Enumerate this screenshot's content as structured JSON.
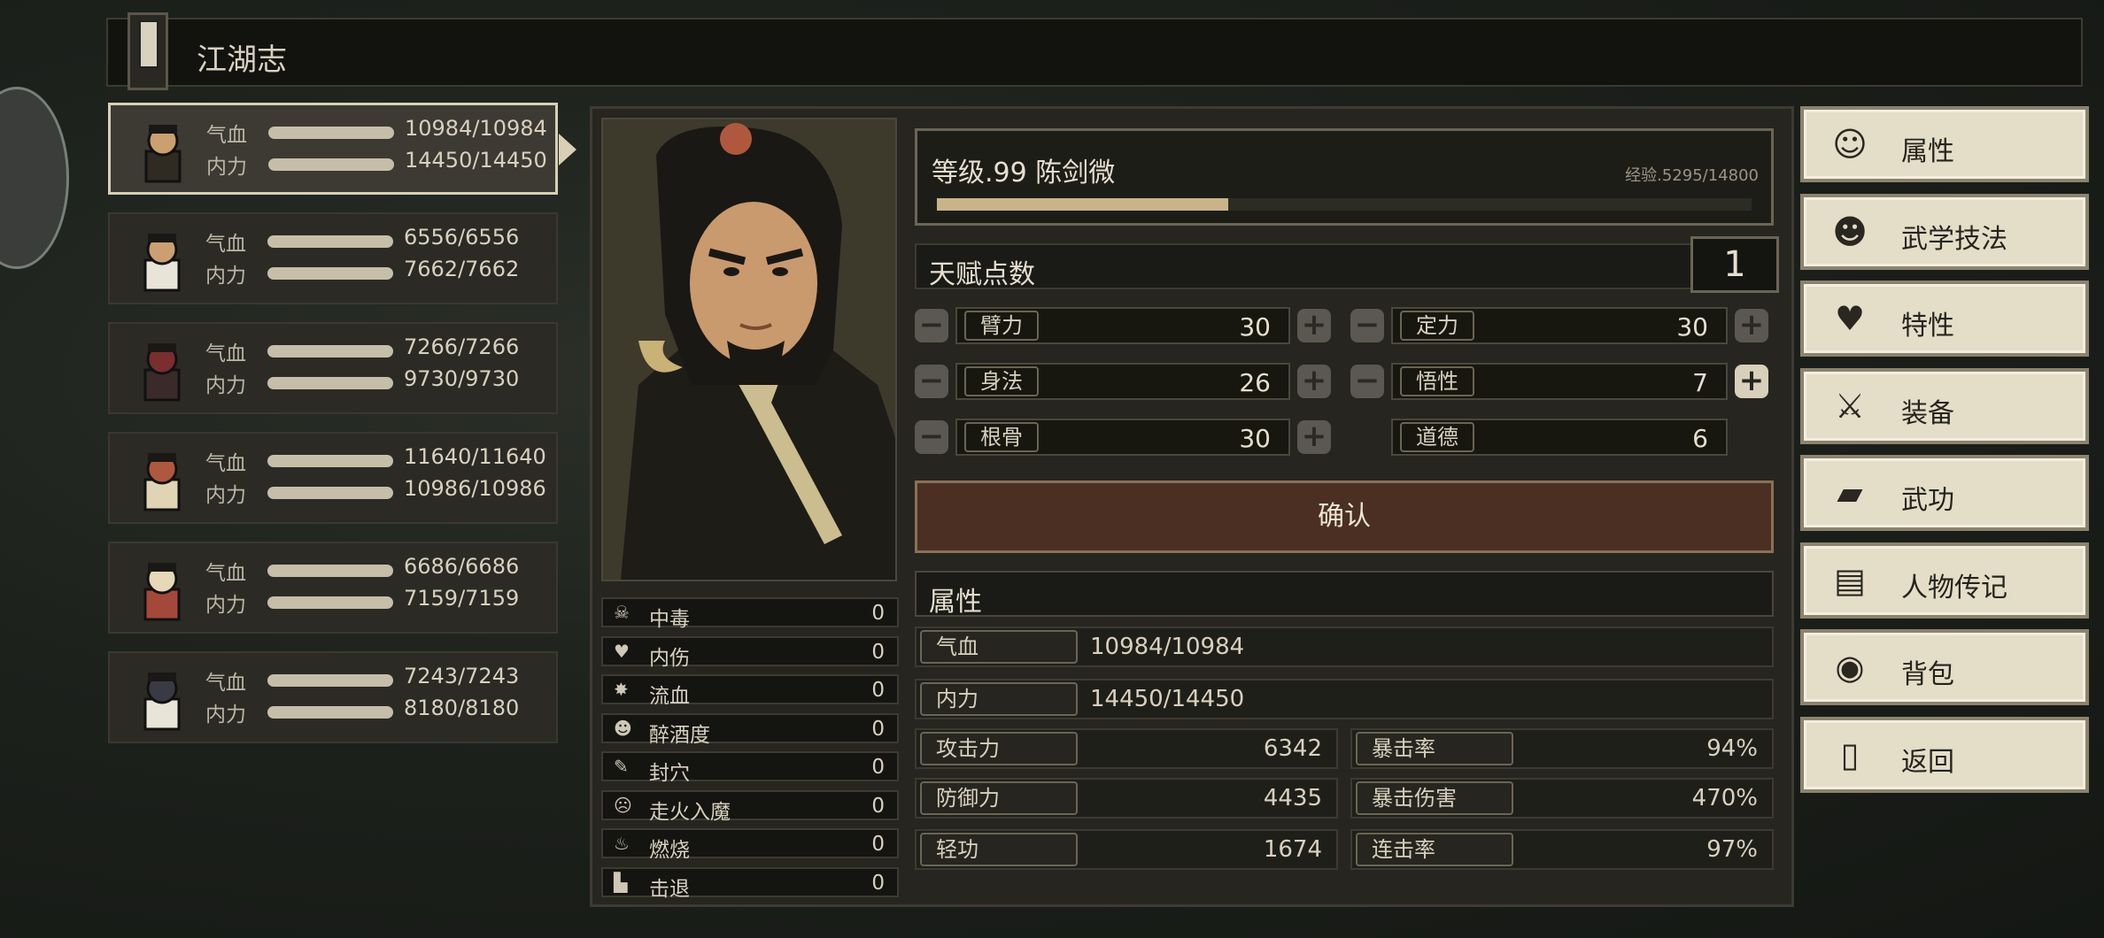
{
  "window": {
    "title": "江湖志"
  },
  "roster": [
    {
      "hp_label": "气血",
      "hp": "10984/10984",
      "mp_label": "内力",
      "mp": "14450/14450",
      "selected": true
    },
    {
      "hp_label": "气血",
      "hp": "6556/6556",
      "mp_label": "内力",
      "mp": "7662/7662"
    },
    {
      "hp_label": "气血",
      "hp": "7266/7266",
      "mp_label": "内力",
      "mp": "9730/9730"
    },
    {
      "hp_label": "气血",
      "hp": "11640/11640",
      "mp_label": "内力",
      "mp": "10986/10986"
    },
    {
      "hp_label": "气血",
      "hp": "6686/6686",
      "mp_label": "内力",
      "mp": "7159/7159"
    },
    {
      "hp_label": "气血",
      "hp": "7243/7243",
      "mp_label": "内力",
      "mp": "8180/8180"
    }
  ],
  "status_effects": [
    {
      "icon": "skull-icon",
      "glyph": "☠",
      "label": "中毒",
      "value": "0"
    },
    {
      "icon": "broken-heart-icon",
      "glyph": "♥",
      "label": "内伤",
      "value": "0"
    },
    {
      "icon": "blood-drop-icon",
      "glyph": "✸",
      "label": "流血",
      "value": "0"
    },
    {
      "icon": "drunk-face-icon",
      "glyph": "☻",
      "label": "醉酒度",
      "value": "0"
    },
    {
      "icon": "acupoint-seal-icon",
      "glyph": "✎",
      "label": "封穴",
      "value": "0"
    },
    {
      "icon": "demon-face-icon",
      "glyph": "☹",
      "label": "走火入魔",
      "value": "0"
    },
    {
      "icon": "flame-icon",
      "glyph": "♨",
      "label": "燃烧",
      "value": "0"
    },
    {
      "icon": "boot-icon",
      "glyph": "▙",
      "label": "击退",
      "value": "0"
    }
  ],
  "character": {
    "level_text": "等级.99  陈剑微",
    "exp_text": "经验.5295/14800",
    "exp_fraction": 0.358
  },
  "talent": {
    "label": "天赋点数",
    "points": "1"
  },
  "attributes": [
    {
      "name": "臂力",
      "value": "30"
    },
    {
      "name": "定力",
      "value": "30"
    },
    {
      "name": "身法",
      "value": "26"
    },
    {
      "name": "悟性",
      "value": "7"
    },
    {
      "name": "根骨",
      "value": "30"
    },
    {
      "name": "道德",
      "value": "6"
    }
  ],
  "confirm_label": "确认",
  "stats": {
    "section_label": "属性",
    "hp": {
      "label": "气血",
      "value": "10984/10984"
    },
    "mp": {
      "label": "内力",
      "value": "14450/14450"
    },
    "attack": {
      "label": "攻击力",
      "value": "6342"
    },
    "crit_rate": {
      "label": "暴击率",
      "value": "94%"
    },
    "defense": {
      "label": "防御力",
      "value": "4435"
    },
    "crit_damage": {
      "label": "暴击伤害",
      "value": "470%"
    },
    "agility": {
      "label": "轻功",
      "value": "1674"
    },
    "combo_rate": {
      "label": "连击率",
      "value": "97%"
    }
  },
  "menu": [
    {
      "label": "属性",
      "icon": "person-stats-icon",
      "glyph": "☺"
    },
    {
      "label": "武学技法",
      "icon": "martial-technique-icon",
      "glyph": "☻"
    },
    {
      "label": "特性",
      "icon": "trait-heart-icon",
      "glyph": "♥"
    },
    {
      "label": "装备",
      "icon": "sword-icon",
      "glyph": "⚔"
    },
    {
      "label": "武功",
      "icon": "scroll-book-icon",
      "glyph": "▰"
    },
    {
      "label": "人物传记",
      "icon": "biography-book-icon",
      "glyph": "▤"
    },
    {
      "label": "背包",
      "icon": "bag-icon",
      "glyph": "◉"
    },
    {
      "label": "返回",
      "icon": "door-icon",
      "glyph": "▯"
    }
  ]
}
